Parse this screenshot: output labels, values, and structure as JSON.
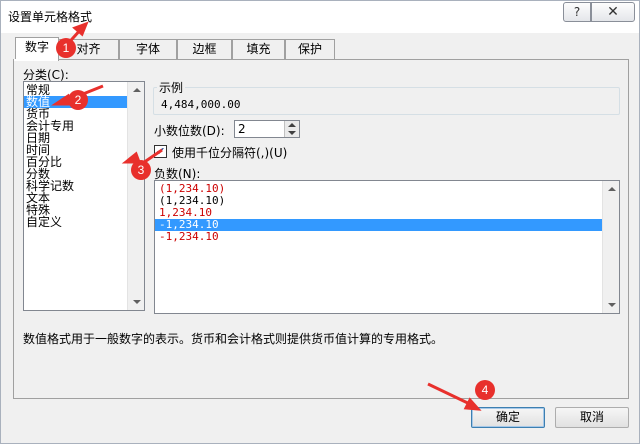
{
  "window": {
    "title": "设置单元格格式",
    "help_glyph": "?",
    "close_glyph": "✕"
  },
  "tabs": [
    "数字",
    "对齐",
    "字体",
    "边框",
    "填充",
    "保护"
  ],
  "category": {
    "label": "分类(C):",
    "items": [
      "常规",
      "数值",
      "货币",
      "会计专用",
      "日期",
      "时间",
      "百分比",
      "分数",
      "科学记数",
      "文本",
      "特殊",
      "自定义"
    ],
    "selected_index": 1
  },
  "sample": {
    "label": "示例",
    "value": "4,484,000.00"
  },
  "decimal_places": {
    "label": "小数位数(D):",
    "value": "2"
  },
  "thousands": {
    "label": "使用千位分隔符(,)(U)",
    "check": "✔",
    "checked": true
  },
  "negative_numbers": {
    "label": "负数(N):",
    "items": [
      {
        "text": "(1,234.10)",
        "color": "#cc0000"
      },
      {
        "text": "(1,234.10)",
        "color": "#000000"
      },
      {
        "text": "1,234.10",
        "color": "#cc0000"
      },
      {
        "text": "-1,234.10",
        "color": "#000000"
      },
      {
        "text": "-1,234.10",
        "color": "#cc0000"
      }
    ],
    "selected_index": 3
  },
  "description": "数值格式用于一般数字的表示。货币和会计格式则提供货币值计算的专用格式。",
  "buttons": {
    "ok": "确定",
    "cancel": "取消"
  },
  "annotations": [
    "1",
    "2",
    "3",
    "4"
  ],
  "colors": {
    "selection": "#3399ff",
    "annotation": "#e8302c"
  }
}
